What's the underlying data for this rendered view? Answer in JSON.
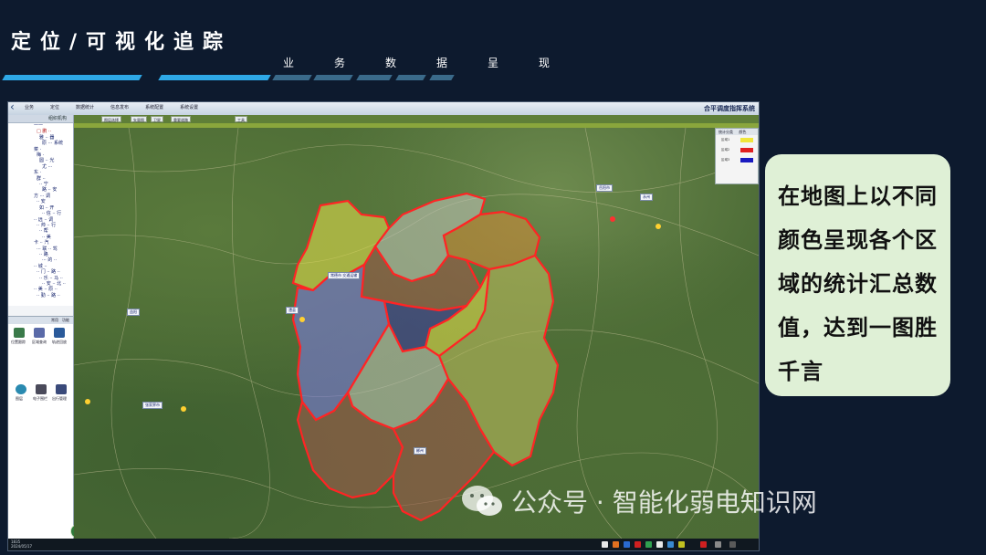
{
  "slide": {
    "title": "定位/可视化追踪",
    "subtitle_chars": [
      "业",
      "务",
      "数",
      "据",
      "呈",
      "现"
    ]
  },
  "app": {
    "title": "合平调度指挥系统",
    "menu": [
      "业务",
      "定位",
      "数据统计",
      "信息发布",
      "系统配置",
      "系统设置"
    ],
    "toolbar_buttons": [
      "图层选择",
      "矢量图",
      "卫星",
      "重要道路",
      "工具"
    ],
    "panel_title": "组织机构",
    "tree_items": [
      {
        "label": "一一",
        "red": false
      },
      {
        "label": "□ 鹏 ··",
        "red": true
      },
      {
        "label": "雅 ·· 器",
        "red": false
      },
      {
        "label": "原 ··· 系统",
        "red": false
      },
      {
        "label": "菜 ·",
        "red": false
      },
      {
        "label": "梅 ·",
        "red": false
      },
      {
        "label": "圆 ·· 光",
        "red": false
      },
      {
        "label": "尤 ···",
        "red": false
      },
      {
        "label": "东 ·",
        "red": false
      },
      {
        "label": "群 ··",
        "red": false
      },
      {
        "label": "·· 宁",
        "red": false
      },
      {
        "label": "路 ·· 安",
        "red": false
      },
      {
        "label": "方 ··· 调",
        "red": false
      },
      {
        "label": "·· 安",
        "red": false
      },
      {
        "label": "如 ·· 开",
        "red": false
      },
      {
        "label": "·· 信 ·· 行",
        "red": false
      },
      {
        "label": "·· 远 ·· 调",
        "red": false
      },
      {
        "label": "·· 帅 ·· 行",
        "red": false
      },
      {
        "label": "·· 帮",
        "red": false
      },
      {
        "label": "·· 美",
        "red": false
      },
      {
        "label": "卡 ·· 汽",
        "red": false
      },
      {
        "label": "··· 联 ·· 驾",
        "red": false
      },
      {
        "label": "·· 路",
        "red": false
      },
      {
        "label": "··· 的 ··",
        "red": false
      },
      {
        "label": "·· 城 ··",
        "red": false
      },
      {
        "label": "·· 门 ·· 路 ··",
        "red": false
      },
      {
        "label": "·· 乐 ·· 马 ··",
        "red": false
      },
      {
        "label": "·· 安 ·· 北 ··",
        "red": false
      },
      {
        "label": "·· 美 ·· 原 ··",
        "red": false
      },
      {
        "label": "·· 勤 ·· 路 ··",
        "red": false
      }
    ],
    "panel2_tabs": [
      "常用",
      "功能"
    ],
    "panel2_icons": [
      "位置跟踪",
      "区域查询",
      "轨迹回放",
      "图层",
      "电子围栏",
      "出行管理"
    ],
    "status_text": [
      "1835",
      "2024/05/17"
    ],
    "legend": {
      "header": [
        "统计分类",
        "颜色"
      ],
      "rows": [
        {
          "label": "区域1",
          "color": "#f0e63a"
        },
        {
          "label": "区域2",
          "color": "#e02020"
        },
        {
          "label": "区域3",
          "color": "#1a1ac0"
        }
      ]
    },
    "city_tags": [
      "常德市 交通运输",
      "澧县",
      "益阳",
      "永州",
      "郴州",
      "张家界市",
      "岳阳市"
    ],
    "map_colors": {
      "yellow": "#d8d84a",
      "blue": "#7a7ad8",
      "dark_blue": "#3c3c9a",
      "brown": "#9a5a4a",
      "orange": "#c88a3a",
      "gray": "#b9c0b0",
      "olive": "#b4b85a",
      "border": "#ff2020"
    }
  },
  "callout": {
    "text": "在地图上以不同颜色呈现各个区域的统计汇总数值，达到一图胜千言"
  },
  "watermark": {
    "text": "公众号 · 智能化弱电知识网"
  }
}
